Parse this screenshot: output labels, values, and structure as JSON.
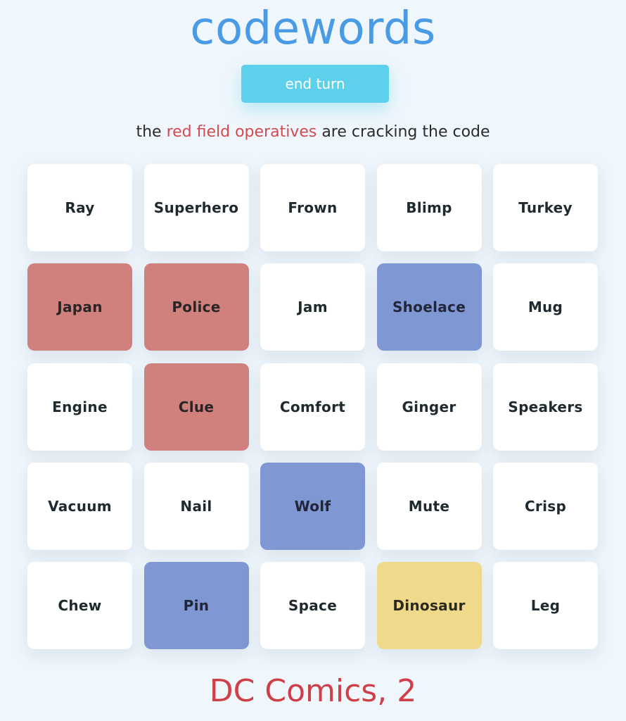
{
  "header": {
    "title": "codewords",
    "end_turn_label": "end turn"
  },
  "status": {
    "prefix": "the",
    "team": "red field operatives",
    "suffix": "are cracking the code"
  },
  "colors": {
    "title": "#4a9be6",
    "end_turn_button": "#5dd0ec",
    "red_team": "#d0817e",
    "blue_team": "#7f97d3",
    "neutral_revealed": "#efd98a",
    "unrevealed": "#ffffff",
    "clue_text": "#cf3f48"
  },
  "board": {
    "cards": [
      {
        "word": "Ray",
        "state": "unrevealed"
      },
      {
        "word": "Superhero",
        "state": "unrevealed"
      },
      {
        "word": "Frown",
        "state": "unrevealed"
      },
      {
        "word": "Blimp",
        "state": "unrevealed"
      },
      {
        "word": "Turkey",
        "state": "unrevealed"
      },
      {
        "word": "Japan",
        "state": "red"
      },
      {
        "word": "Police",
        "state": "red"
      },
      {
        "word": "Jam",
        "state": "unrevealed"
      },
      {
        "word": "Shoelace",
        "state": "blue"
      },
      {
        "word": "Mug",
        "state": "unrevealed"
      },
      {
        "word": "Engine",
        "state": "unrevealed"
      },
      {
        "word": "Clue",
        "state": "red"
      },
      {
        "word": "Comfort",
        "state": "unrevealed"
      },
      {
        "word": "Ginger",
        "state": "unrevealed"
      },
      {
        "word": "Speakers",
        "state": "unrevealed"
      },
      {
        "word": "Vacuum",
        "state": "unrevealed"
      },
      {
        "word": "Nail",
        "state": "unrevealed"
      },
      {
        "word": "Wolf",
        "state": "blue"
      },
      {
        "word": "Mute",
        "state": "unrevealed"
      },
      {
        "word": "Crisp",
        "state": "unrevealed"
      },
      {
        "word": "Chew",
        "state": "unrevealed"
      },
      {
        "word": "Pin",
        "state": "blue"
      },
      {
        "word": "Space",
        "state": "unrevealed"
      },
      {
        "word": "Dinosaur",
        "state": "yellow"
      },
      {
        "word": "Leg",
        "state": "unrevealed"
      }
    ]
  },
  "clue": {
    "text": "DC Comics, 2"
  }
}
